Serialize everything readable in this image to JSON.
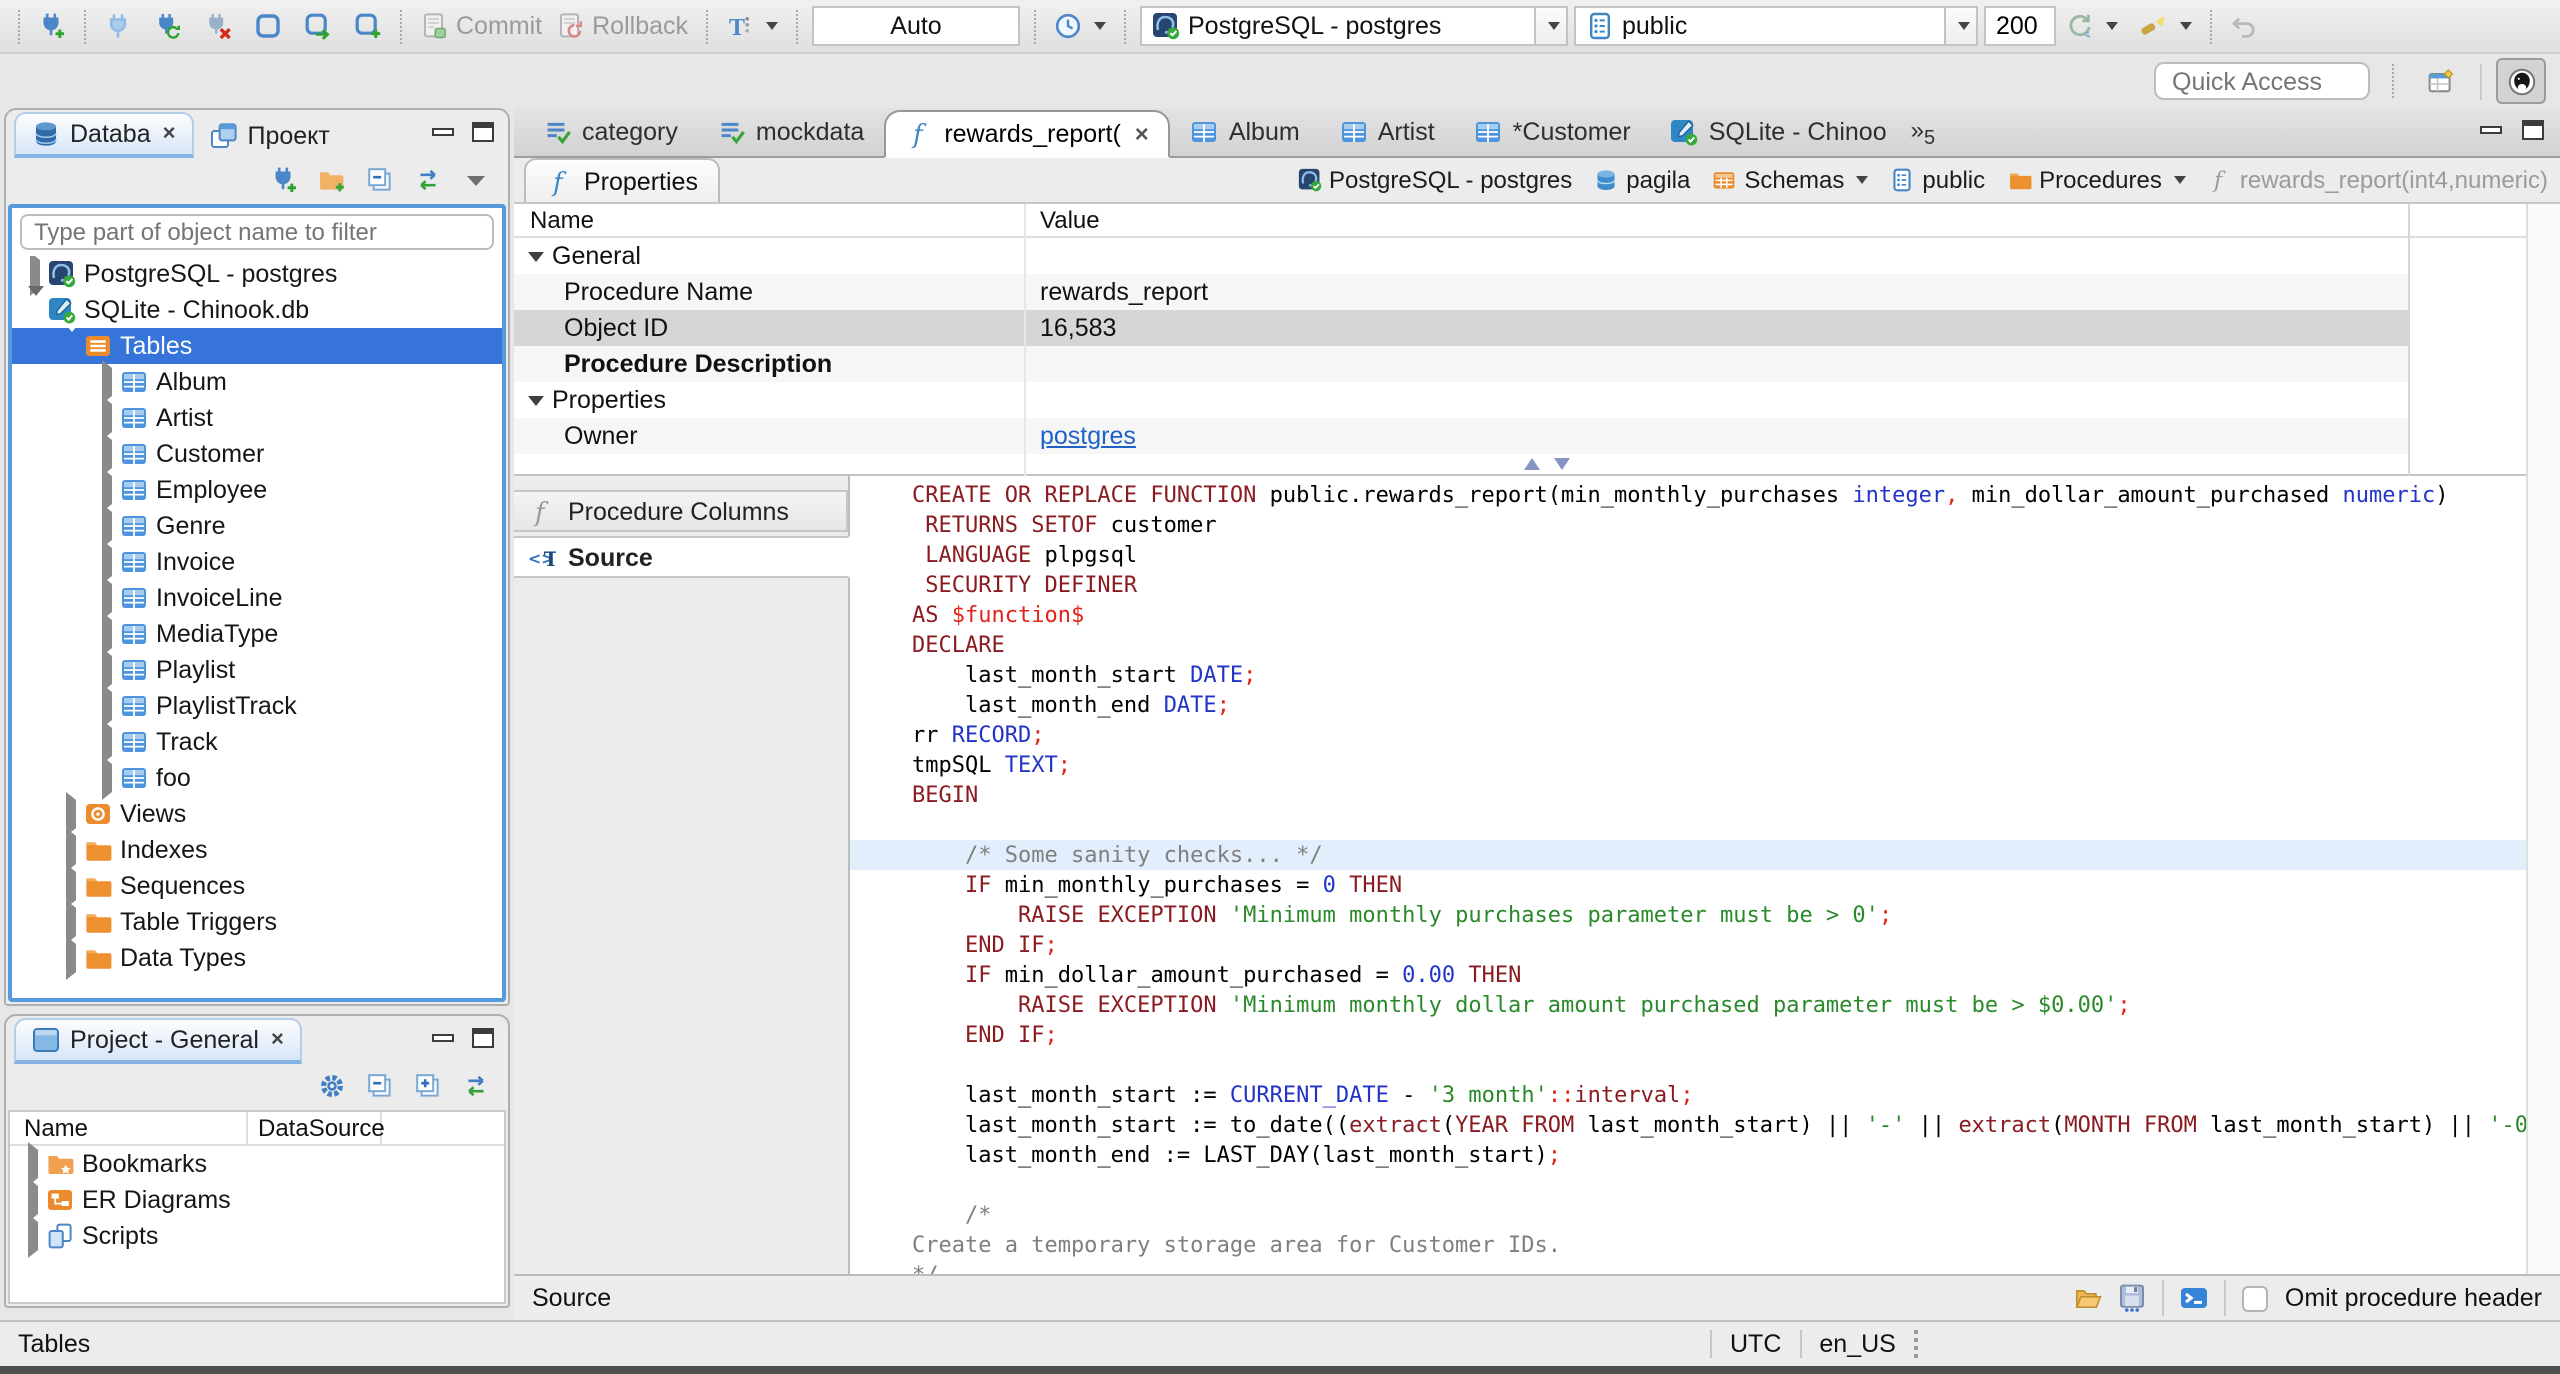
{
  "colors": {
    "selection": "#3674d9",
    "link": "#1f62c5",
    "tab_accent": "#85b2e4"
  },
  "toolbar": {
    "group_connect": [
      "connection-new"
    ],
    "group_session": [
      "connection",
      "connection-invalidate",
      "disconnect",
      "sql-editor",
      "sql-editor-new",
      "sql-editor-recent"
    ],
    "commit_label": "Commit",
    "rollback_label": "Rollback",
    "txn_filter_icon": "txn-filter",
    "txn_mode": "Auto",
    "history_icon": "clock",
    "connection_value": "PostgreSQL - postgres",
    "connection_icon": "postgres",
    "schema_value": "public",
    "schema_icon": "schema",
    "result_rows": "200",
    "group_fetch": [
      {
        "icon": "refresh-rows",
        "caret": true
      },
      {
        "icon": "search-metadata",
        "caret": true
      }
    ],
    "undo_icon": "undo",
    "quick_access": "Quick Access",
    "right_icons": [
      "perspective",
      "dbeaver-logo"
    ]
  },
  "navigator": {
    "tabs": [
      {
        "label": "Databa",
        "icon": "db-navigator",
        "active": true,
        "closable": true
      },
      {
        "label": "Проект",
        "icon": "projects"
      }
    ],
    "toolbar_icons": [
      "connection-new",
      "folder-new",
      "collapse-all",
      "link-editor",
      "view-menu"
    ],
    "filter_placeholder": "Type part of object name to filter",
    "tree": [
      {
        "label": "PostgreSQL - postgres",
        "icon": "postgres",
        "level": 0,
        "expand": "closed"
      },
      {
        "label": "SQLite - Chinook.db",
        "icon": "sqlite",
        "level": 0,
        "expand": "open"
      },
      {
        "label": "Tables",
        "icon": "tables",
        "level": 1,
        "expand": "open",
        "selected": true
      },
      {
        "label": "Album",
        "icon": "table",
        "level": 2,
        "expand": "closed"
      },
      {
        "label": "Artist",
        "icon": "table",
        "level": 2,
        "expand": "closed"
      },
      {
        "label": "Customer",
        "icon": "table",
        "level": 2,
        "expand": "closed"
      },
      {
        "label": "Employee",
        "icon": "table",
        "level": 2,
        "expand": "closed"
      },
      {
        "label": "Genre",
        "icon": "table",
        "level": 2,
        "expand": "closed"
      },
      {
        "label": "Invoice",
        "icon": "table",
        "level": 2,
        "expand": "closed"
      },
      {
        "label": "InvoiceLine",
        "icon": "table",
        "level": 2,
        "expand": "closed"
      },
      {
        "label": "MediaType",
        "icon": "table",
        "level": 2,
        "expand": "closed"
      },
      {
        "label": "Playlist",
        "icon": "table",
        "level": 2,
        "expand": "closed"
      },
      {
        "label": "PlaylistTrack",
        "icon": "table",
        "level": 2,
        "expand": "closed"
      },
      {
        "label": "Track",
        "icon": "table",
        "level": 2,
        "expand": "closed"
      },
      {
        "label": "foo",
        "icon": "table",
        "level": 2,
        "expand": "closed"
      },
      {
        "label": "Views",
        "icon": "view",
        "level": 1,
        "expand": "closed"
      },
      {
        "label": "Indexes",
        "icon": "folder",
        "level": 1,
        "expand": "closed"
      },
      {
        "label": "Sequences",
        "icon": "folder",
        "level": 1,
        "expand": "closed"
      },
      {
        "label": "Table Triggers",
        "icon": "folder",
        "level": 1,
        "expand": "closed"
      },
      {
        "label": "Data Types",
        "icon": "folder",
        "level": 1,
        "expand": "closed"
      }
    ]
  },
  "project_panel": {
    "tab": {
      "label": "Project - General",
      "icon": "project",
      "closable": true
    },
    "toolbar_icons": [
      "settings",
      "collapse-all",
      "expand-all",
      "link-editor"
    ],
    "columns": [
      "Name",
      "DataSource"
    ],
    "items": [
      {
        "label": "Bookmarks",
        "icon": "bookmarks"
      },
      {
        "label": "ER Diagrams",
        "icon": "er-diagrams"
      },
      {
        "label": "Scripts",
        "icon": "scripts"
      }
    ]
  },
  "editor_tabs": {
    "tabs": [
      {
        "label": "category",
        "icon": "sql-script"
      },
      {
        "label": "mockdata",
        "icon": "sql-script"
      },
      {
        "label": "rewards_report(",
        "icon": "function",
        "active": true,
        "closable": true
      },
      {
        "label": "Album",
        "icon": "table"
      },
      {
        "label": "Artist",
        "icon": "table"
      },
      {
        "label": "*Customer",
        "icon": "table"
      },
      {
        "label": "SQLite - Chinoo",
        "icon": "sqlite"
      }
    ],
    "overflow_count": "5"
  },
  "properties_view": {
    "tab_label": "Properties",
    "breadcrumb": [
      {
        "label": "PostgreSQL - postgres",
        "icon": "postgres"
      },
      {
        "label": "pagila",
        "icon": "database"
      },
      {
        "label": "Schemas",
        "icon": "schemas",
        "dropdown": true
      },
      {
        "label": "public",
        "icon": "schema"
      },
      {
        "label": "Procedures",
        "icon": "folder",
        "dropdown": true
      },
      {
        "label": "rewards_report(int4,numeric)",
        "icon": "function-gray",
        "muted": true
      }
    ],
    "columns": [
      "Name",
      "Value"
    ],
    "rows": [
      {
        "type": "group",
        "name": "General"
      },
      {
        "type": "prop",
        "name": "Procedure Name",
        "value": "rewards_report"
      },
      {
        "type": "prop",
        "name": "Object ID",
        "value": "16,583",
        "selected": true
      },
      {
        "type": "prop",
        "name": "Procedure Description",
        "value": "",
        "bold": true
      },
      {
        "type": "group",
        "name": "Properties"
      },
      {
        "type": "prop",
        "name": "Owner",
        "value": "postgres",
        "link": true
      }
    ],
    "subtabs": [
      {
        "label": "Procedure Columns",
        "icon": "function-gray"
      },
      {
        "label": "Source",
        "icon": "source",
        "active": true
      }
    ]
  },
  "source_editor": {
    "token_colors": {
      "kw": "#8a1c21",
      "ty": "#2134c6",
      "num": "#2134c6",
      "str": "#2a8a2a",
      "pun": "#e02419",
      "com": "#7f7f7f",
      "pl": "#000000"
    },
    "highlight_line": 13,
    "lines": [
      [
        {
          "c": "kw",
          "t": "CREATE OR REPLACE FUNCTION"
        },
        {
          "c": "pl",
          "t": " public.rewards_report(min_monthly_purchases "
        },
        {
          "c": "ty",
          "t": "integer"
        },
        {
          "c": "pun",
          "t": ","
        },
        {
          "c": "pl",
          "t": " min_dollar_amount_purchased "
        },
        {
          "c": "ty",
          "t": "numeric"
        },
        {
          "c": "pl",
          "t": ")"
        }
      ],
      [
        {
          "c": "pl",
          "t": " "
        },
        {
          "c": "kw",
          "t": "RETURNS SETOF"
        },
        {
          "c": "pl",
          "t": " customer"
        }
      ],
      [
        {
          "c": "pl",
          "t": " "
        },
        {
          "c": "kw",
          "t": "LANGUAGE"
        },
        {
          "c": "pl",
          "t": " plpgsql"
        }
      ],
      [
        {
          "c": "pl",
          "t": " "
        },
        {
          "c": "kw",
          "t": "SECURITY DEFINER"
        }
      ],
      [
        {
          "c": "kw",
          "t": "AS"
        },
        {
          "c": "pl",
          "t": " "
        },
        {
          "c": "pun",
          "t": "$function$"
        }
      ],
      [
        {
          "c": "kw",
          "t": "DECLARE"
        }
      ],
      [
        {
          "c": "pl",
          "t": "    last_month_start "
        },
        {
          "c": "ty",
          "t": "DATE"
        },
        {
          "c": "pun",
          "t": ";"
        }
      ],
      [
        {
          "c": "pl",
          "t": "    last_month_end "
        },
        {
          "c": "ty",
          "t": "DATE"
        },
        {
          "c": "pun",
          "t": ";"
        }
      ],
      [
        {
          "c": "pl",
          "t": "rr "
        },
        {
          "c": "ty",
          "t": "RECORD"
        },
        {
          "c": "pun",
          "t": ";"
        }
      ],
      [
        {
          "c": "pl",
          "t": "tmpSQL "
        },
        {
          "c": "ty",
          "t": "TEXT"
        },
        {
          "c": "pun",
          "t": ";"
        }
      ],
      [
        {
          "c": "kw",
          "t": "BEGIN"
        }
      ],
      [],
      [
        {
          "c": "pl",
          "t": "    "
        },
        {
          "c": "com",
          "t": "/* Some sanity checks... */"
        }
      ],
      [
        {
          "c": "pl",
          "t": "    "
        },
        {
          "c": "kw",
          "t": "IF"
        },
        {
          "c": "pl",
          "t": " min_monthly_purchases = "
        },
        {
          "c": "num",
          "t": "0"
        },
        {
          "c": "pl",
          "t": " "
        },
        {
          "c": "kw",
          "t": "THEN"
        }
      ],
      [
        {
          "c": "pl",
          "t": "        "
        },
        {
          "c": "kw",
          "t": "RAISE EXCEPTION"
        },
        {
          "c": "pl",
          "t": " "
        },
        {
          "c": "str",
          "t": "'Minimum monthly purchases parameter must be > 0'"
        },
        {
          "c": "pun",
          "t": ";"
        }
      ],
      [
        {
          "c": "pl",
          "t": "    "
        },
        {
          "c": "kw",
          "t": "END IF"
        },
        {
          "c": "pun",
          "t": ";"
        }
      ],
      [
        {
          "c": "pl",
          "t": "    "
        },
        {
          "c": "kw",
          "t": "IF"
        },
        {
          "c": "pl",
          "t": " min_dollar_amount_purchased = "
        },
        {
          "c": "num",
          "t": "0.00"
        },
        {
          "c": "pl",
          "t": " "
        },
        {
          "c": "kw",
          "t": "THEN"
        }
      ],
      [
        {
          "c": "pl",
          "t": "        "
        },
        {
          "c": "kw",
          "t": "RAISE EXCEPTION"
        },
        {
          "c": "pl",
          "t": " "
        },
        {
          "c": "str",
          "t": "'Minimum monthly dollar amount purchased parameter must be > $0.00'"
        },
        {
          "c": "pun",
          "t": ";"
        }
      ],
      [
        {
          "c": "pl",
          "t": "    "
        },
        {
          "c": "kw",
          "t": "END IF"
        },
        {
          "c": "pun",
          "t": ";"
        }
      ],
      [],
      [
        {
          "c": "pl",
          "t": "    last_month_start := "
        },
        {
          "c": "ty",
          "t": "CURRENT_DATE"
        },
        {
          "c": "pl",
          "t": " - "
        },
        {
          "c": "str",
          "t": "'3 month'"
        },
        {
          "c": "pun",
          "t": "::"
        },
        {
          "c": "kw",
          "t": "interval"
        },
        {
          "c": "pun",
          "t": ";"
        }
      ],
      [
        {
          "c": "pl",
          "t": "    last_month_start := to_date(("
        },
        {
          "c": "kw",
          "t": "extract"
        },
        {
          "c": "pl",
          "t": "("
        },
        {
          "c": "kw",
          "t": "YEAR FROM"
        },
        {
          "c": "pl",
          "t": " last_month_start) || "
        },
        {
          "c": "str",
          "t": "'-'"
        },
        {
          "c": "pl",
          "t": " || "
        },
        {
          "c": "kw",
          "t": "extract"
        },
        {
          "c": "pl",
          "t": "("
        },
        {
          "c": "kw",
          "t": "MONTH FROM"
        },
        {
          "c": "pl",
          "t": " last_month_start) || "
        },
        {
          "c": "str",
          "t": "'-0"
        }
      ],
      [
        {
          "c": "pl",
          "t": "    last_month_end := LAST_DAY(last_month_start)"
        },
        {
          "c": "pun",
          "t": ";"
        }
      ],
      [],
      [
        {
          "c": "pl",
          "t": "    "
        },
        {
          "c": "com",
          "t": "/*"
        }
      ],
      [
        {
          "c": "com",
          "t": "Create a temporary storage area for Customer IDs."
        }
      ],
      [
        {
          "c": "com",
          "t": "*/"
        }
      ]
    ]
  },
  "bottom_bar": {
    "label": "Source",
    "icons": [
      "open-file",
      "save-to-file",
      "shell-console"
    ],
    "checkbox_label": "Omit procedure header",
    "checked": false
  },
  "status_bar": {
    "left": "Tables",
    "timezone": "UTC",
    "locale": "en_US"
  }
}
